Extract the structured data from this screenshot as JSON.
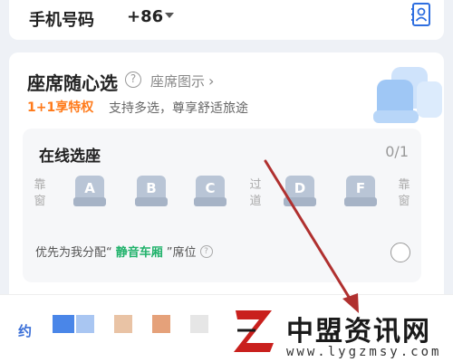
{
  "phone_row": {
    "label": "手机号码",
    "country_code": "+86",
    "contact_icon": "contact-book-icon"
  },
  "seat_section": {
    "title": "座席随心选",
    "seat_map_link": "座席图示",
    "promo_tag": "1+1享特权",
    "promo_desc": "支持多选，尊享舒适旅途",
    "online": {
      "title": "在线选座",
      "count": "0/1",
      "window_left": "靠窗",
      "aisle": "过道",
      "window_right": "靠窗",
      "seats": [
        "A",
        "B",
        "C",
        "D",
        "F"
      ],
      "assign_prefix": "优先为我分配“",
      "assign_highlight": "静音车厢",
      "assign_suffix": "”席位"
    }
  },
  "bottom": {
    "partial_label": "约"
  },
  "watermark": {
    "name": "中盟资讯网",
    "url": "www.lygzmsy.com"
  },
  "colors": {
    "accent_orange": "#ff7a1a",
    "accent_green": "#20b26b",
    "seat_blue_grey": "#b9c5d6",
    "arrow_red": "#b0302f"
  }
}
